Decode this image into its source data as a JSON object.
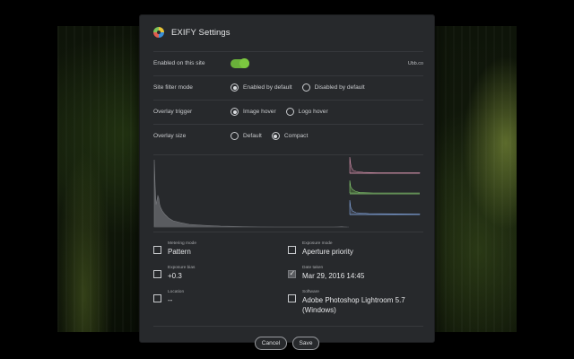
{
  "dialog": {
    "title": "EXIFY Settings",
    "icons": {
      "logo": "aperture-logo-icon",
      "checked": "check-icon"
    }
  },
  "settings": {
    "enabled": {
      "label": "Enabled on this site",
      "value": true,
      "site": "Ubb.co"
    },
    "filter_mode": {
      "label": "Site filter mode",
      "options": [
        "Enabled by default",
        "Disabled by default"
      ],
      "selected": "Enabled by default"
    },
    "overlay_trigger": {
      "label": "Overlay trigger",
      "options": [
        "Image hover",
        "Logo hover"
      ],
      "selected": "Image hover"
    },
    "overlay_size": {
      "label": "Overlay size",
      "options": [
        "Default",
        "Compact"
      ],
      "selected": "Compact"
    }
  },
  "histogram": {
    "luminance_color": "#6b6d70",
    "channel_colors": [
      "#d08fa9",
      "#84c96e",
      "#7e9fd6"
    ]
  },
  "fields": [
    {
      "label": "Metering mode",
      "value": "Pattern",
      "checked": false
    },
    {
      "label": "Exposure mode",
      "value": "Aperture priority",
      "checked": false
    },
    {
      "label": "Exposure bias",
      "value": "+0.3",
      "checked": false
    },
    {
      "label": "Date taken",
      "value": "Mar 29, 2016 14:45",
      "checked": true
    },
    {
      "label": "Location",
      "value": "--",
      "checked": false
    },
    {
      "label": "Software",
      "value": "Adobe Photoshop Lightroom 5.7 (Windows)",
      "checked": false
    }
  ],
  "buttons": {
    "cancel": "Cancel",
    "save": "Save"
  },
  "colors": {
    "panel": "#27292c",
    "accent": "#6ab03a"
  }
}
